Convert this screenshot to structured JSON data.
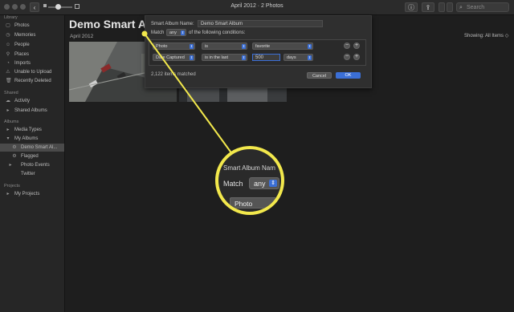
{
  "window": {
    "title": "April 2012 · 2 Photos",
    "back_glyph": "‹",
    "search_placeholder": "Search"
  },
  "sidebar": {
    "library_header": "Library",
    "library": [
      "Photos",
      "Memories",
      "People",
      "Places",
      "Imports",
      "Unable to Upload",
      "Recently Deleted"
    ],
    "shared_header": "Shared",
    "shared": [
      "Activity",
      "Shared Albums"
    ],
    "albums_header": "Albums",
    "albums": [
      "Media Types",
      "My Albums",
      "Demo Smart Al...",
      "Flagged",
      "Photo Events",
      "Twitter"
    ],
    "projects_header": "Projects",
    "projects": [
      "My Projects"
    ]
  },
  "main": {
    "title": "Demo Smart Alb",
    "date": "April 2012",
    "showing": "Showing: All Items ◇"
  },
  "sheet": {
    "name_label": "Smart Album Name:",
    "name_value": "Demo Smart Album",
    "match_prefix": "Match",
    "match_value": "any",
    "match_suffix": "of the following conditions:",
    "rule1": {
      "field": "Photo",
      "op": "is",
      "value": "favorite"
    },
    "rule2": {
      "field": "Date Captured",
      "op": "is in the last",
      "amount": "500",
      "unit": "days"
    },
    "count": "2,122 items matched",
    "cancel": "Cancel",
    "ok": "OK"
  },
  "zoom": {
    "name_label": "Smart Album Nam",
    "match_prefix": "Match",
    "match_value": "any",
    "match_suffix_cut": "o",
    "field_value": "Photo"
  },
  "colors": {
    "accent": "#3b6fd6",
    "highlight": "#f2e84c"
  }
}
